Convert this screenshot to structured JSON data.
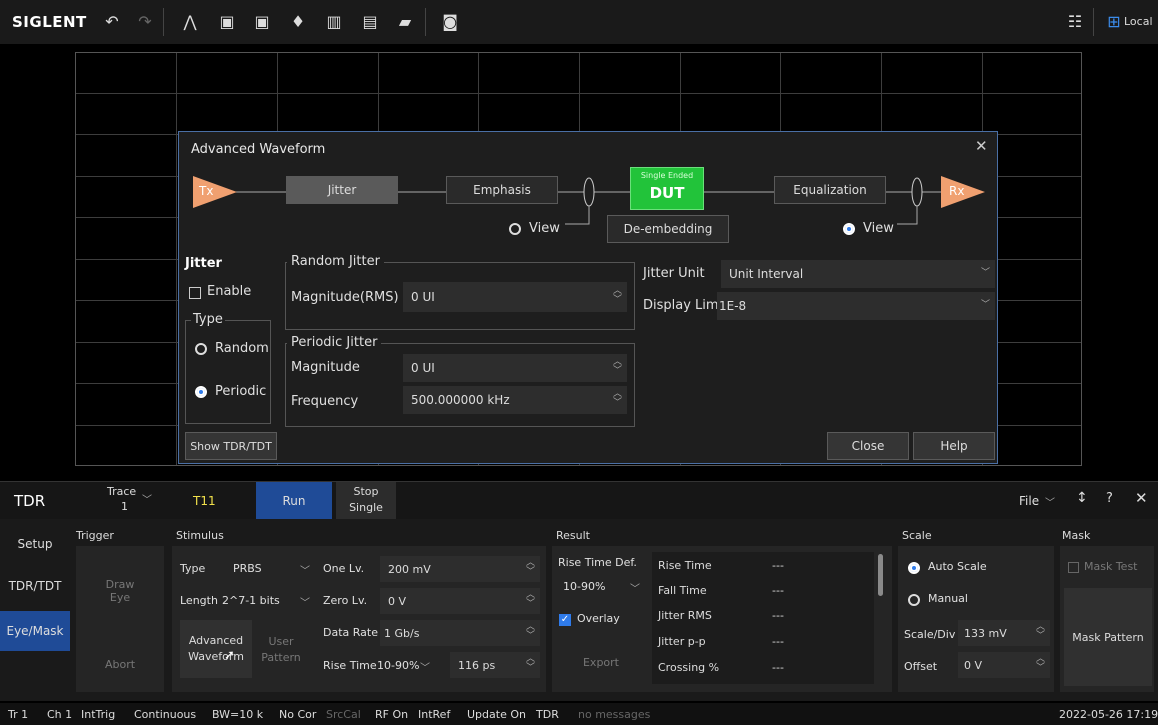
{
  "brand": "SIGLENT",
  "toolbar": {
    "local_label": "Local"
  },
  "dialog": {
    "title": "Advanced Waveform",
    "chain": {
      "tx": "Tx",
      "rx": "Rx",
      "jitter": "Jitter",
      "emphasis": "Emphasis",
      "dut_top": "Single Ended",
      "dut": "DUT",
      "equalization": "Equalization",
      "deembedding": "De-embedding",
      "view_left": "View",
      "view_right": "View"
    },
    "jitter": {
      "heading": "Jitter",
      "enable": "Enable",
      "type_label": "Type",
      "random": "Random",
      "periodic": "Periodic",
      "type_selected": "Periodic"
    },
    "random_jitter": {
      "heading": "Random Jitter",
      "magnitude_label": "Magnitude(RMS)",
      "magnitude": "0 UI"
    },
    "periodic_jitter": {
      "heading": "Periodic Jitter",
      "magnitude_label": "Magnitude",
      "magnitude": "0 UI",
      "frequency_label": "Frequency",
      "frequency": "500.000000 kHz"
    },
    "jitter_unit_label": "Jitter Unit",
    "jitter_unit": "Unit Interval",
    "display_limit_label": "Display Limit",
    "display_limit": "1E-8",
    "show_tdr": "Show TDR/TDT",
    "close": "Close",
    "help": "Help"
  },
  "panel": {
    "mode": "TDR",
    "trace_label": "Trace",
    "trace_value": "1",
    "trace_name": "T11",
    "run": "Run",
    "stop": "Stop",
    "single": "Single",
    "file": "File",
    "tabs": [
      "Setup",
      "TDR/TDT",
      "Eye/Mask"
    ],
    "active_tab": "Eye/Mask",
    "trigger": {
      "heading": "Trigger",
      "draw_eye": "Draw\nEye",
      "abort": "Abort"
    },
    "stimulus": {
      "heading": "Stimulus",
      "type_label": "Type",
      "type": "PRBS",
      "length_label": "Length",
      "length": "2^7-1 bits",
      "one_label": "One Lv.",
      "one": "200 mV",
      "zero_label": "Zero Lv.",
      "zero": "0 V",
      "rate_label": "Data Rate",
      "rate": "1 Gb/s",
      "rise_label": "Rise Time",
      "rise_mode": "10-90%",
      "rise": "116 ps",
      "advanced": "Advanced\nWaveform",
      "user": "User\nPattern"
    },
    "result": {
      "heading": "Result",
      "rise_def_label": "Rise Time Def.",
      "rise_def": "10-90%",
      "overlay": "Overlay",
      "export": "Export",
      "rows": [
        {
          "name": "Rise Time",
          "value": "---"
        },
        {
          "name": "Fall Time",
          "value": "---"
        },
        {
          "name": "Jitter RMS",
          "value": "---"
        },
        {
          "name": "Jitter p-p",
          "value": "---"
        },
        {
          "name": "Crossing %",
          "value": "---"
        }
      ]
    },
    "scale": {
      "heading": "Scale",
      "auto": "Auto Scale",
      "manual": "Manual",
      "div_label": "Scale/Div",
      "div": "133 mV",
      "offset_label": "Offset",
      "offset": "0 V"
    },
    "mask": {
      "heading": "Mask",
      "test": "Mask Test",
      "pattern": "Mask Pattern"
    }
  },
  "status": [
    "Tr 1",
    "Ch 1",
    "IntTrig",
    "Continuous",
    "BW=10 k",
    "No Cor",
    "SrcCal",
    "RF On",
    "IntRef",
    "Update On",
    "TDR",
    "no messages",
    "2022-05-26 17:19"
  ]
}
